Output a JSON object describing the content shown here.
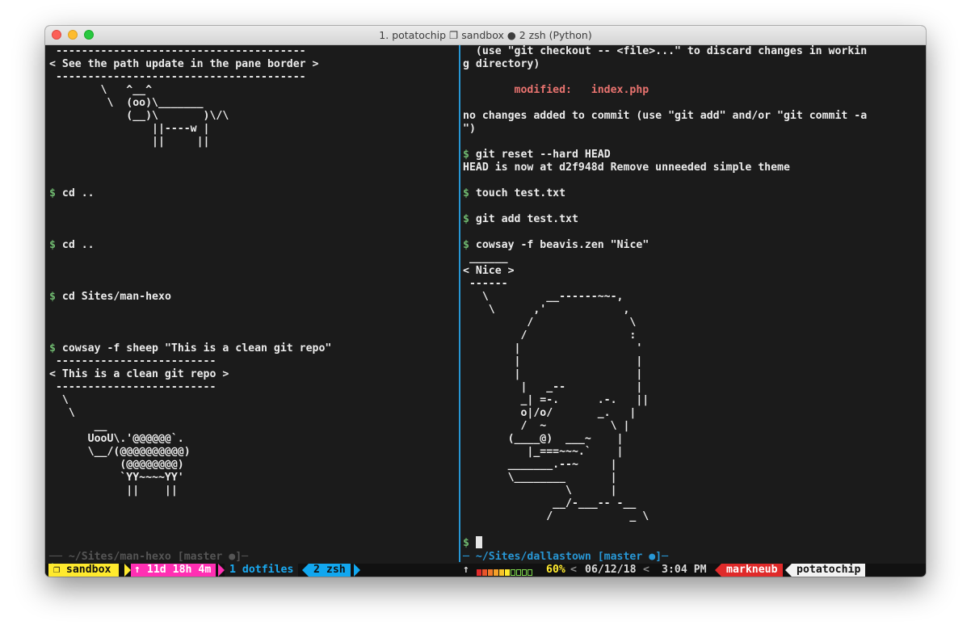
{
  "window": {
    "title": "1. potatochip ❐ sandbox ● 2 zsh (Python)"
  },
  "left_pane": {
    "sheep_bubble_top": " ---------------------------------------",
    "sheep_bubble_text": "< See the path update in the pane border >",
    "sheep_bubble_bottom": " ---------------------------------------",
    "cow_art": "        \\   ^__^\n         \\  (oo)\\_______\n            (__)\\       )\\/\\\n                ||----w |\n                ||     ||",
    "prompt_symbol": "$",
    "commands": [
      "cd ..",
      "cd ..",
      "cd Sites/man-hexo",
      "cowsay -f sheep \"This is a clean git repo\""
    ],
    "sheep_bubble2_top": " -------------------------",
    "sheep_bubble2_text": "< This is a clean git repo >",
    "sheep_bubble2_bottom": " -------------------------",
    "sheep_art": "  \\\n   \\\n       __\n      UooU\\.'@@@@@@`.\n      \\__/(@@@@@@@@@@)\n           (@@@@@@@@)\n           `YY~~~~YY'\n            ||    ||",
    "border_path": "── ~/Sites/man-hexo [master ●]─"
  },
  "right_pane": {
    "line1": "  (use \"git checkout -- <file>...\" to discard changes in workin",
    "line2": "g directory)",
    "modified_line": "        modified:   index.php",
    "line3": "no changes added to commit (use \"git add\" and/or \"git commit -a",
    "line4": "\")",
    "cmd_reset": "git reset --hard HEAD",
    "reset_output": "HEAD is now at d2f948d Remove unneeded simple theme",
    "cmd_touch": "touch test.txt",
    "cmd_add": "git add test.txt",
    "cmd_cowsay": "cowsay -f beavis.zen \"Nice\"",
    "nice_bubble_top": " ______",
    "nice_bubble_text": "< Nice >",
    "nice_bubble_bottom": " ------",
    "beavis_art": "   \\         __------~~-,\n    \\      ,'            ,\n          /               \\\n         /                :\n        |                  '\n        |                  |\n        |                  |\n         |   _--           |\n         _| =-.      .-.   ||\n         o|/o/       _.   |\n         /  ~          \\ |\n       (____@)  ___~    |\n          |_===~~~.`    |\n       _______.--~     |\n       \\________       |\n                \\      |\n              __/-___-- -__\n             /            _ \\",
    "prompt_symbol": "$",
    "border_path": "─ ~/Sites/dallastown [master ●]─"
  },
  "statusbar": {
    "session": "❐ sandbox",
    "uptime": "↑ 11d 18h 4m",
    "window1": "1 dotfiles",
    "window2": "2 zsh",
    "battery_arrow": "↑",
    "battery_percent": "60%",
    "battery_level": 0.6,
    "date": "06/12/18",
    "time": "3:04 PM",
    "user": "markneub",
    "host": "potatochip"
  },
  "colors": {
    "prompt": "#6fb86f",
    "border_active": "#2897d5",
    "session_bg": "#ffea2e",
    "uptime_bg": "#ff2fb3",
    "window2_bg": "#12a7ef",
    "user_bg": "#e02a2a"
  }
}
